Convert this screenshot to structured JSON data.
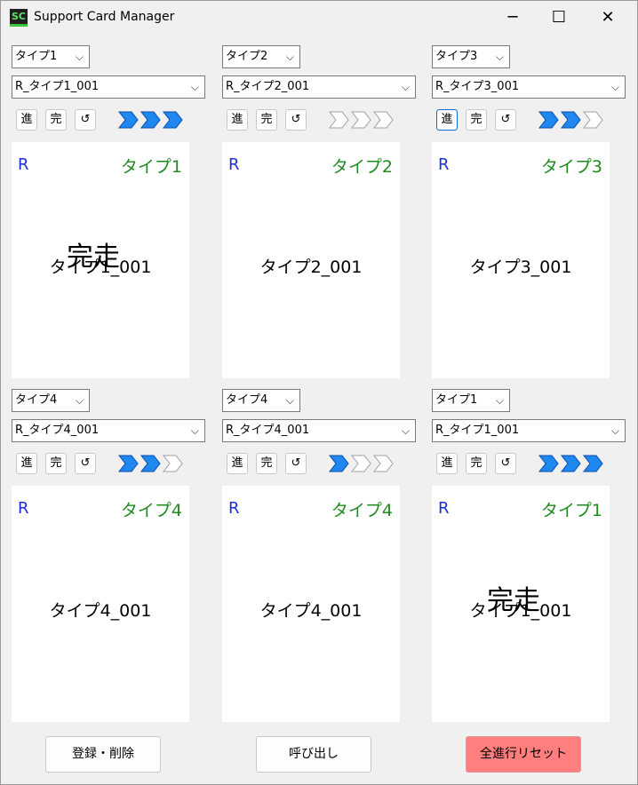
{
  "window": {
    "icon_text": "SC",
    "title": "Support Card Manager",
    "minimize": "─",
    "maximize": "☐",
    "close": "✕"
  },
  "slots": [
    {
      "type": "タイプ1",
      "card": "R_タイプ1_001",
      "rarity": "R",
      "card_type": "タイプ1",
      "card_name": "タイプ1_001",
      "progress": 3,
      "completed": true,
      "complete_label": "完走"
    },
    {
      "type": "タイプ2",
      "card": "R_タイプ2_001",
      "rarity": "R",
      "card_type": "タイプ2",
      "card_name": "タイプ2_001",
      "progress": 0,
      "completed": false,
      "complete_label": ""
    },
    {
      "type": "タイプ3",
      "card": "R_タイプ3_001",
      "rarity": "R",
      "card_type": "タイプ3",
      "card_name": "タイプ3_001",
      "progress": 2,
      "completed": false,
      "complete_label": ""
    },
    {
      "type": "タイプ4",
      "card": "R_タイプ4_001",
      "rarity": "R",
      "card_type": "タイプ4",
      "card_name": "タイプ4_001",
      "progress": 2,
      "completed": false,
      "complete_label": ""
    },
    {
      "type": "タイプ4",
      "card": "R_タイプ4_001",
      "rarity": "R",
      "card_type": "タイプ4",
      "card_name": "タイプ4_001",
      "progress": 1,
      "completed": false,
      "complete_label": ""
    },
    {
      "type": "タイプ1",
      "card": "R_タイプ1_001",
      "rarity": "R",
      "card_type": "タイプ1",
      "card_name": "タイプ1_001",
      "progress": 3,
      "completed": true,
      "complete_label": "完走"
    }
  ],
  "slot_buttons": {
    "advance": "進",
    "complete": "完",
    "reset": "↺"
  },
  "bottom": {
    "register": "登録・削除",
    "load": "呼び出し",
    "reset_all": "全進行リセット"
  },
  "colors": {
    "arrow_filled": "#1f87f0",
    "arrow_empty": "#ffffff",
    "reset_all_bg": "#ff7f7f",
    "type_text": "#1f8a1f",
    "rarity_text": "#1a2fd6"
  }
}
